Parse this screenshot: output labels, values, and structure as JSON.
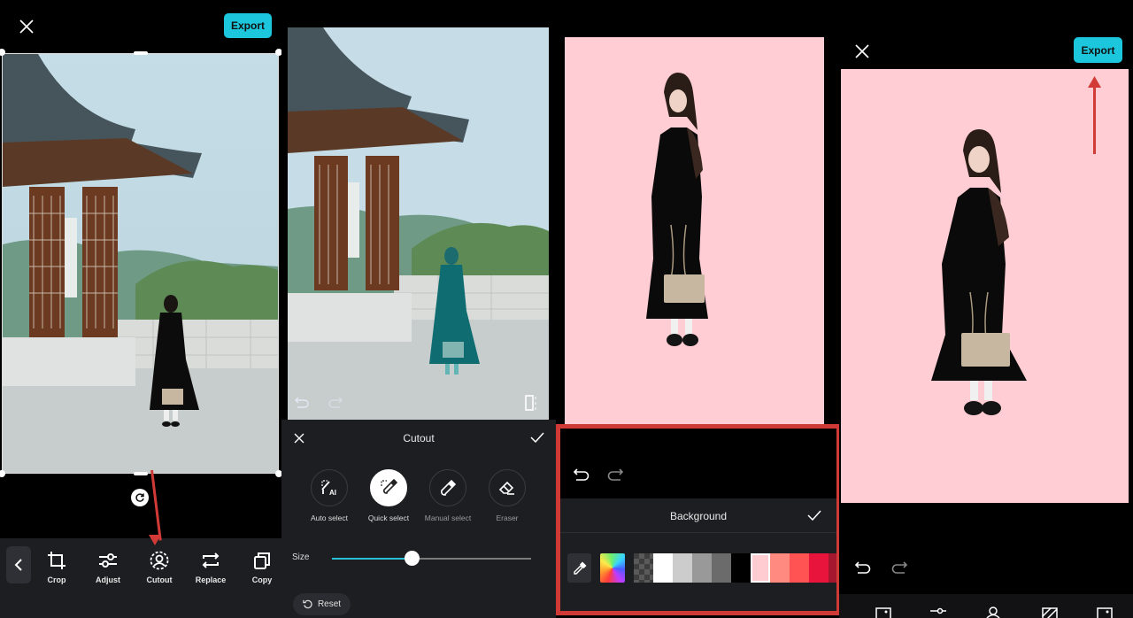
{
  "panel1": {
    "close_icon": "close-icon",
    "export_label": "Export",
    "rotate_icon": "rotate-icon",
    "back_icon": "chevron-left-icon",
    "tools": [
      {
        "label": "Crop",
        "icon": "crop-icon"
      },
      {
        "label": "Adjust",
        "icon": "sliders-icon"
      },
      {
        "label": "Cutout",
        "icon": "person-cutout-icon"
      },
      {
        "label": "Replace",
        "icon": "replace-icon"
      },
      {
        "label": "Copy",
        "icon": "copy-icon"
      }
    ],
    "annotation": "red arrow pointing to Cutout"
  },
  "panel2": {
    "sheet_title": "Cutout",
    "cancel_icon": "close-icon",
    "confirm_icon": "check-icon",
    "modes": [
      {
        "label": "Auto select",
        "icon": "ai-select-icon",
        "active": false
      },
      {
        "label": "Quick select",
        "icon": "quick-select-brush-icon",
        "active": true
      },
      {
        "label": "Manual select",
        "icon": "brush-icon",
        "active": false
      },
      {
        "label": "Eraser",
        "icon": "eraser-icon",
        "active": false
      }
    ],
    "size_label": "Size",
    "size_value_percent": 40,
    "reset_label": "Reset",
    "compare_icon": "compare-icon"
  },
  "panel3": {
    "canvas_color": "#ffcdd3",
    "sheet_title": "Background",
    "confirm_icon": "check-icon",
    "undo_icon": "undo-icon",
    "redo_icon": "redo-icon",
    "eyedropper_icon": "eyedropper-icon",
    "swatches": [
      {
        "type": "transparent"
      },
      {
        "color": "#ffffff"
      },
      {
        "color": "#cccccc"
      },
      {
        "color": "#999999"
      },
      {
        "color": "#6b6b6b"
      },
      {
        "color": "#000000"
      },
      {
        "color": "#ffccd2",
        "selected": true
      },
      {
        "color": "#ff8a80"
      },
      {
        "color": "#ff5252"
      },
      {
        "color": "#e8143c"
      },
      {
        "color": "#a5172f"
      }
    ],
    "highlight_color": "#cf3a36"
  },
  "panel4": {
    "close_icon": "close-icon",
    "export_label": "Export",
    "canvas_color": "#ffcdd3",
    "undo_icon": "undo-icon",
    "redo_icon": "redo-icon",
    "bottom_icons": [
      "image-icon",
      "adjust-icon",
      "cutout-icon",
      "opacity-icon",
      "image-icon"
    ],
    "annotation": "red arrow pointing to Export"
  },
  "colors": {
    "accent": "#1cc6dc",
    "panel_bg": "#1d1e22",
    "annotation_red": "#d23a37"
  }
}
